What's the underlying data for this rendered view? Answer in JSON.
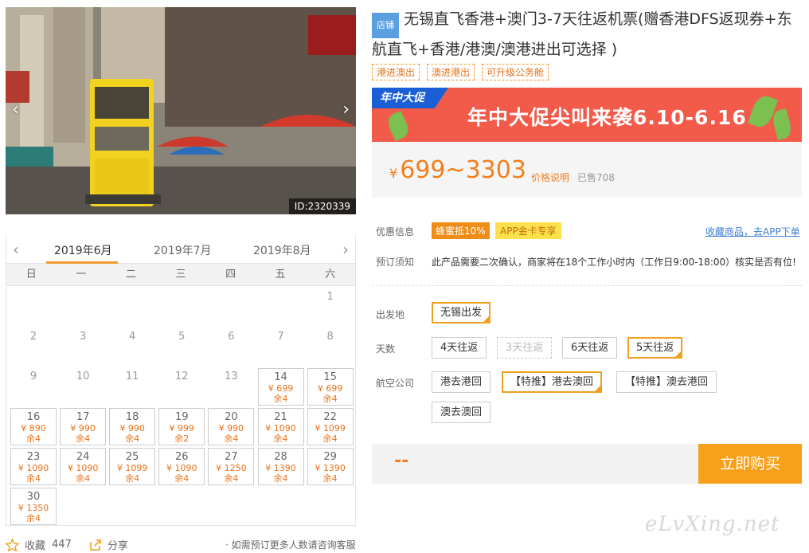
{
  "photo": {
    "id_label": "ID:2320339",
    "prev_arrow": "‹",
    "next_arrow": "›"
  },
  "calendar": {
    "prev_arrow": "‹",
    "next_arrow": "›",
    "months": [
      "2019年6月",
      "2019年7月",
      "2019年8月"
    ],
    "active_month_index": 0,
    "weekdays": [
      "日",
      "一",
      "二",
      "三",
      "四",
      "五",
      "六"
    ],
    "days": [
      {
        "d": "1"
      },
      {
        "d": "2"
      },
      {
        "d": "3"
      },
      {
        "d": "4"
      },
      {
        "d": "5"
      },
      {
        "d": "6"
      },
      {
        "d": "7"
      },
      {
        "d": "8"
      },
      {
        "d": "9"
      },
      {
        "d": "10"
      },
      {
        "d": "11"
      },
      {
        "d": "12"
      },
      {
        "d": "13"
      },
      {
        "d": "14",
        "p": "¥ 699",
        "r": "余4"
      },
      {
        "d": "15",
        "p": "¥ 699",
        "r": "余4"
      },
      {
        "d": "16",
        "p": "¥ 890",
        "r": "余4"
      },
      {
        "d": "17",
        "p": "¥ 990",
        "r": "余4"
      },
      {
        "d": "18",
        "p": "¥ 990",
        "r": "余4"
      },
      {
        "d": "19",
        "p": "¥ 999",
        "r": "余2"
      },
      {
        "d": "20",
        "p": "¥ 990",
        "r": "余4"
      },
      {
        "d": "21",
        "p": "¥ 1090",
        "r": "余4"
      },
      {
        "d": "22",
        "p": "¥ 1099",
        "r": "余4"
      },
      {
        "d": "23",
        "p": "¥ 1090",
        "r": "余4"
      },
      {
        "d": "24",
        "p": "¥ 1090",
        "r": "余4"
      },
      {
        "d": "25",
        "p": "¥ 1099",
        "r": "余4"
      },
      {
        "d": "26",
        "p": "¥ 1090",
        "r": "余4"
      },
      {
        "d": "27",
        "p": "¥ 1250",
        "r": "余4"
      },
      {
        "d": "28",
        "p": "¥ 1390",
        "r": "余4"
      },
      {
        "d": "29",
        "p": "¥ 1390",
        "r": "余4"
      },
      {
        "d": "30",
        "p": "¥ 1350",
        "r": "余4"
      }
    ]
  },
  "footer": {
    "favorite_label": "收藏",
    "favorite_count": "447",
    "share_label": "分享",
    "consult_note": "· 如需预订更多人数请咨询客服"
  },
  "product": {
    "shop_tag": "店铺",
    "title": "无锡直飞香港+澳门3-7天往返机票(赠香港DFS返现券+东航直飞+香港/港澳/澳港进出可选择 )",
    "tags": [
      "港进澳出",
      "澳进港出",
      "可升级公务舱"
    ]
  },
  "banner": {
    "logo": "年中大促",
    "text": "年中大促尖叫来袭6.10-6.16"
  },
  "price": {
    "currency": "¥",
    "range": "699~3303",
    "note": "价格说明",
    "sold": "已售708"
  },
  "promo": {
    "label": "优惠信息",
    "badge1": "蜂蜜抵10%",
    "badge2": "APP金卡专享",
    "fav_link": "收藏商品，去APP下单"
  },
  "notice": {
    "label": "预订须知",
    "text": "此产品需要二次确认，商家将在18个工作小时内（工作日9:00-18:00）核实是否有位!"
  },
  "options": {
    "departure_label": "出发地",
    "departure": [
      "无锡出发"
    ],
    "days_label": "天数",
    "days": [
      "4天往返",
      "3天往返",
      "6天往返",
      "5天往返"
    ],
    "airline_label": "航空公司",
    "airline": [
      "港去港回",
      "【特推】港去澳回",
      "【特推】澳去港回",
      "澳去澳回"
    ]
  },
  "buy": {
    "price_placeholder": "--",
    "button": "立即购买"
  },
  "watermark": "eLvXing.net",
  "colors": {
    "accent": "#f08020",
    "button": "#f8a01a",
    "selected_border": "#f0a020",
    "link": "#3b7fd6",
    "banner": "#f25b4a"
  }
}
